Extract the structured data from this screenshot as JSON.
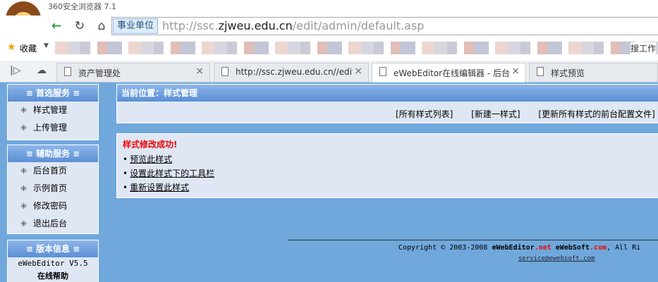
{
  "browser": {
    "title": "360安全浏览器 7.1",
    "nav": {
      "back_icon": "←",
      "refresh_icon": "↻",
      "home_icon": "⌂"
    },
    "zone_label": "事业单位",
    "url": {
      "prefix": "http://ssc.",
      "host": "zjweu.edu.cn",
      "path": "/edit/admin/default.asp"
    },
    "favorites_label": "收藏",
    "bookmark_tail": "搜工作",
    "tabs": [
      {
        "label": "资产管理处"
      },
      {
        "label": "http://ssc.zjweu.edu.cn//edit/"
      },
      {
        "label": "eWebEditor在线编辑器 - 后台"
      },
      {
        "label": "样式预览"
      }
    ]
  },
  "sidebar": {
    "main": {
      "title": "首选服务",
      "items": [
        "样式管理",
        "上传管理"
      ]
    },
    "aux": {
      "title": "辅助服务",
      "items": [
        "后台首页",
        "示例首页",
        "修改密码",
        "退出后台"
      ]
    },
    "version": {
      "title": "版本信息",
      "version_text": "eWebEditor V5.5",
      "help_text": "在线帮助"
    }
  },
  "location": {
    "title": "当前位置：样式管理",
    "links": [
      "[所有样式列表]",
      "[新建一样式]",
      "[更新所有样式的前台配置文件]"
    ]
  },
  "message": {
    "title": "样式修改成功!",
    "links": [
      "预览此样式",
      "设置此样式下的工具栏",
      "重新设置此样式"
    ]
  },
  "footer": {
    "copyright_prefix": "Copyright © 2003-2008 ",
    "brand1": "eWebEditor",
    "brand1_dot": ".net",
    "brand2": " eWebSoft",
    "brand2_dot": ".com",
    "suffix": ", All Ri",
    "email": "service@ewebsoft.com"
  },
  "colors": {
    "header_blue": "#5b8fd4",
    "page_bg": "#70a8dc",
    "panel_bg": "#dfe7f5",
    "success_red": "#e00000"
  }
}
